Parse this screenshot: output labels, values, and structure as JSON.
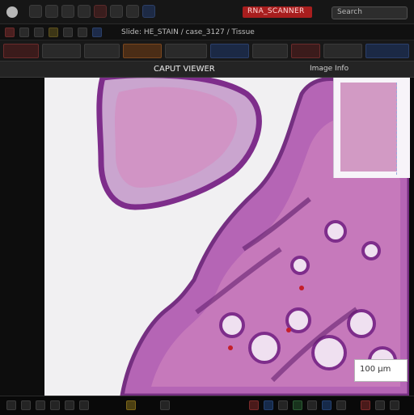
{
  "topbar": {
    "title_tag": "RNA_SCANNER",
    "search_placeholder": "Search"
  },
  "toolbar": {
    "path": "Slide: HE_STAIN / case_3127 / Tissue"
  },
  "titlebar": {
    "window_title": "CAPUT VIEWER",
    "right_info": "Image Info"
  },
  "viewer": {
    "scale_label": "100 µm"
  },
  "colors": {
    "ui_dark": "#161616",
    "ui_bar": "#242424",
    "viewer_bg": "#f1f0f2",
    "tissue_purple": "#7e2d8b",
    "tissue_pink": "#d48ac0",
    "tissue_light": "#efe0f0",
    "alert_red": "#a81e1e"
  }
}
